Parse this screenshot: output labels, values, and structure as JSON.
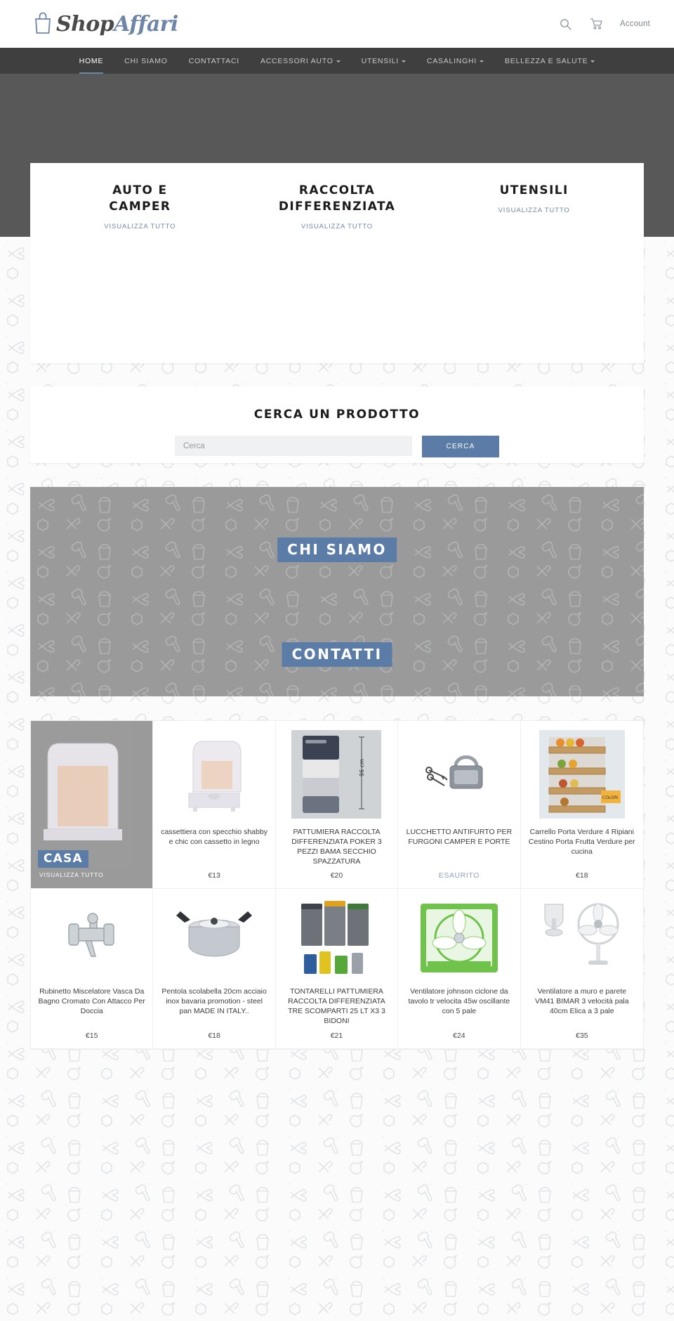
{
  "header": {
    "logo_shop": "Shop",
    "logo_affari": "Affari",
    "logo_bag_icon": "shopping-bag-icon",
    "search_icon": "search-icon",
    "cart_icon": "shopping-cart-icon",
    "account_label": "Account"
  },
  "nav": {
    "items": [
      {
        "label": "HOME",
        "active": true,
        "caret": false
      },
      {
        "label": "CHI SIAMO",
        "active": false,
        "caret": false
      },
      {
        "label": "CONTATTACI",
        "active": false,
        "caret": false
      },
      {
        "label": "ACCESSORI AUTO",
        "active": false,
        "caret": true
      },
      {
        "label": "UTENSILI",
        "active": false,
        "caret": true
      },
      {
        "label": "CASALINGHI",
        "active": false,
        "caret": true
      },
      {
        "label": "BELLEZZA E SALUTE",
        "active": false,
        "caret": true
      }
    ]
  },
  "promos": [
    {
      "title": "AUTO E CAMPER",
      "link": "VISUALIZZA TUTTO"
    },
    {
      "title": "RACCOLTA DIFFERENZIATA",
      "link": "VISUALIZZA TUTTO"
    },
    {
      "title": "UTENSILI",
      "link": "VISUALIZZA TUTTO"
    }
  ],
  "search": {
    "heading": "CERCA UN PRODOTTO",
    "placeholder": "Cerca",
    "value": "",
    "button": "CERCA"
  },
  "banner": {
    "about_label": "CHI SIAMO",
    "contact_label": "CONTATTI"
  },
  "collection_tile": {
    "title": "CASA",
    "link": "VISUALIZZA TUTTO"
  },
  "products": [
    {
      "title": "cassettiera con specchio shabby e chic con cassetto in legno",
      "price": "€13",
      "sold_out": false,
      "image": "white-shabby-mirror-chest"
    },
    {
      "title": "PATTUMIERA RACCOLTA DIFFERENZIATA POKER 3 PEZZI BAMA SECCHIO SPAZZATURA",
      "price": "€20",
      "sold_out": false,
      "image": "stacked-recycling-bins"
    },
    {
      "title": "LUCCHETTO ANTIFURTO PER FURGONI CAMPER E PORTE",
      "price": "ESAURITO",
      "sold_out": true,
      "image": "padlock-with-keys"
    },
    {
      "title": "Carrello Porta Verdure 4 Ripiani Cestino Porta Frutta Verdure per cucina",
      "price": "€18",
      "sold_out": false,
      "image": "wooden-vegetable-trolley"
    },
    {
      "title": "Rubinetto Miscelatore Vasca Da Bagno Cromato Con Attacco Per Doccia",
      "price": "€15",
      "sold_out": false,
      "image": "chrome-bath-mixer-tap"
    },
    {
      "title": "Pentola scolabella 20cm acciaio inox bavaria promotion - steel pan MADE IN ITALY..",
      "price": "€18",
      "sold_out": false,
      "image": "stainless-steel-pot"
    },
    {
      "title": "TONTARELLI PATTUMIERA RACCOLTA DIFFERENZIATA TRE SCOMPARTI 25 LT X3 3 BIDONI",
      "price": "€21",
      "sold_out": false,
      "image": "three-compartment-bins"
    },
    {
      "title": "Ventilatore johnson ciclone da tavolo tr velocita 45w oscillante con 5 pale",
      "price": "€24",
      "sold_out": false,
      "image": "green-box-fan"
    },
    {
      "title": "Ventilatore a muro e parete VM41 BIMAR 3 velocità pala 40cm Elica a 3 pale",
      "price": "€35",
      "sold_out": false,
      "image": "wall-mounted-fan"
    }
  ],
  "colors": {
    "accent": "#5c7ca8",
    "nav_bg": "#3f3f3f",
    "hero_bg": "#585858",
    "banner_bg": "#9a9a9a",
    "page_bg": "#fbfbfb"
  }
}
